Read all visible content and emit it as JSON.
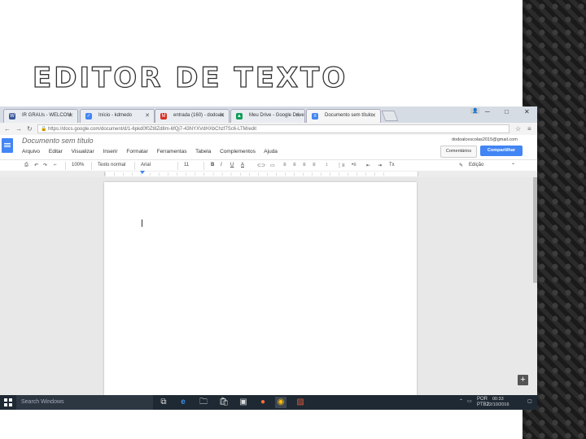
{
  "slide": {
    "title": "EDITOR DE TEXTO"
  },
  "browser": {
    "tabs": [
      {
        "label": "IR GRAUs - WELCOM",
        "color": "#3b5998",
        "glyph": "W"
      },
      {
        "label": "Início - kdmedo",
        "color": "#4285f4",
        "glyph": "✓"
      },
      {
        "label": "entrada (160) - dodoalc",
        "color": "#d93025",
        "glyph": "M"
      },
      {
        "label": "Meu Drive - Google Drive",
        "color": "#0f9d58",
        "glyph": "▲"
      },
      {
        "label": "Documento sem título",
        "color": "#4285f4",
        "glyph": "≡"
      }
    ],
    "url": "https://docs.google.com/document/d/1-6pkd0f0Zt8Zd8m-6fQj7-43NYXVdHXbChzf7Sc6-LTM/edit"
  },
  "docs": {
    "title": "Documento sem título",
    "menu": [
      "Arquivo",
      "Editar",
      "Visualizar",
      "Inserir",
      "Formatar",
      "Ferramentas",
      "Tabela",
      "Complementos",
      "Ajuda"
    ],
    "email": "dodoalcescolas2015@gmail.com",
    "comments_label": "Comentários",
    "share_label": "Compartilhar",
    "toolbar": {
      "zoom": "100%",
      "style": "Texto normal",
      "font": "Arial",
      "size": "11",
      "mode": "Edição"
    }
  },
  "taskbar": {
    "search_placeholder": "Search Windows",
    "lang": "POR",
    "lang2": "PTB2",
    "time": "00:33",
    "date": "22/10/2016"
  }
}
